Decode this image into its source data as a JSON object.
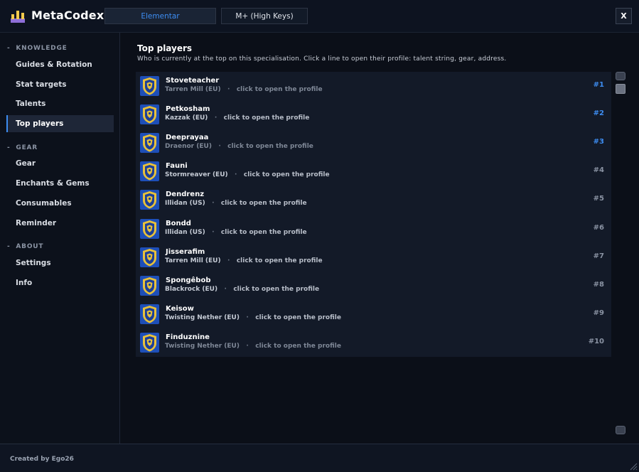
{
  "app": {
    "title": "MetaCodex",
    "tabs": [
      {
        "label": "Elementar",
        "active": true
      },
      {
        "label": "M+ (High Keys)",
        "active": false
      }
    ],
    "close_label": "X"
  },
  "sidebar": {
    "sections": [
      {
        "title": "KNOWLEDGE",
        "items": [
          {
            "label": "Guides & Rotation"
          },
          {
            "label": "Stat targets"
          },
          {
            "label": "Talents"
          },
          {
            "label": "Top players",
            "active": true
          }
        ]
      },
      {
        "title": "GEAR",
        "items": [
          {
            "label": "Gear"
          },
          {
            "label": "Enchants & Gems"
          },
          {
            "label": "Consumables"
          },
          {
            "label": "Reminder"
          }
        ]
      },
      {
        "title": "ABOUT",
        "items": [
          {
            "label": "Settings"
          },
          {
            "label": "Info"
          }
        ]
      }
    ]
  },
  "main": {
    "title": "Top players",
    "subtitle": "Who is currently at the top on this specialisation. Click a line to open their profile: talent string, gear, address.",
    "separator": "·",
    "players": [
      {
        "name": "Stoveteacher",
        "realm": "Tarren Mill (EU)",
        "hint": "click to open the profile",
        "rank": "#1"
      },
      {
        "name": "Petkosham",
        "realm": "Kazzak (EU)",
        "hint": "click to open the profile",
        "rank": "#2"
      },
      {
        "name": "Deeprayaa",
        "realm": "Draenor (EU)",
        "hint": "click to open the profile",
        "rank": "#3"
      },
      {
        "name": "Fauni",
        "realm": "Stormreaver (EU)",
        "hint": "click to open the profile",
        "rank": "#4"
      },
      {
        "name": "Dendrenz",
        "realm": "Illidan (US)",
        "hint": "click to open the profile",
        "rank": "#5"
      },
      {
        "name": "Bondd",
        "realm": "Illidan (US)",
        "hint": "click to open the profile",
        "rank": "#6"
      },
      {
        "name": "Jisserafim",
        "realm": "Tarren Mill (EU)",
        "hint": "click to open the profile",
        "rank": "#7"
      },
      {
        "name": "Spongêbob",
        "realm": "Blackrock (EU)",
        "hint": "click to open the profile",
        "rank": "#8"
      },
      {
        "name": "Keisow",
        "realm": "Twisting Nether (EU)",
        "hint": "click to open the profile",
        "rank": "#9"
      },
      {
        "name": "Finduznine",
        "realm": "Twisting Nether (EU)",
        "hint": "click to open the profile",
        "rank": "#10"
      }
    ]
  },
  "footer": {
    "credit": "Created by Ego26"
  },
  "icons": {
    "logo": "bar-chart-icon",
    "player_crest": "alliance-crest-icon",
    "scroll_up": "scroll-up-arrow-icon",
    "scroll_down": "scroll-down-arrow-icon",
    "resize": "resize-grip-icon"
  },
  "colors": {
    "accent": "#3d8df2",
    "crest_blue": "#1e4fb8",
    "crest_gold": "#e8c13a"
  }
}
